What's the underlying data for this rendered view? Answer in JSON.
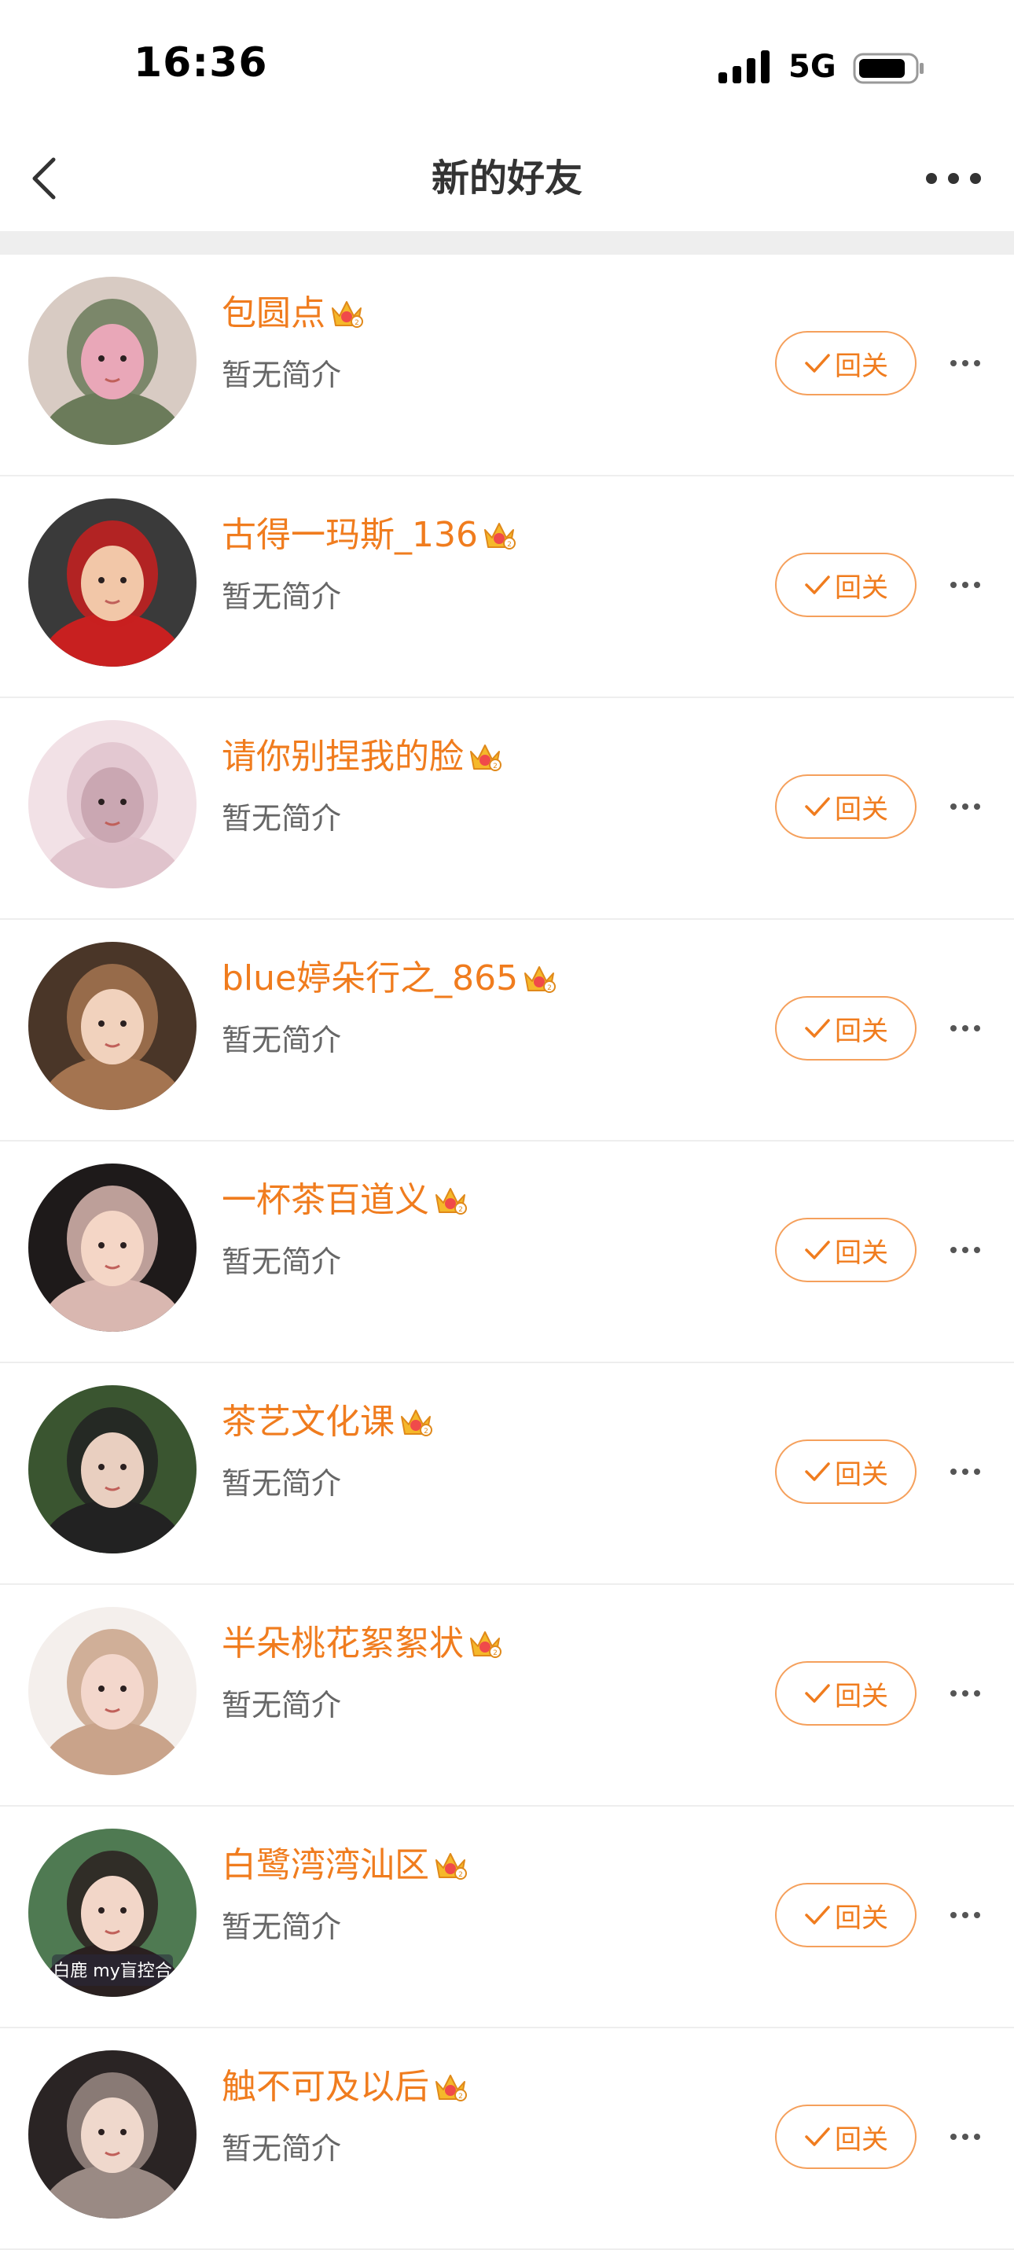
{
  "status_bar": {
    "time": "16:36",
    "network": "5G"
  },
  "nav": {
    "title": "新的好友",
    "back_icon": "chevron-left-icon",
    "more_icon": "more-horizontal-icon"
  },
  "colors": {
    "accent": "#f07c1e",
    "button_border": "#f5a05c",
    "divider": "#eeeeee"
  },
  "friends": [
    {
      "name": "包圆点",
      "bio": "暂无简介",
      "button": "回关",
      "avatar_colors": [
        "#d8cbc3",
        "#6b7b5a",
        "#e9a7b8"
      ]
    },
    {
      "name": "古得一玛斯_136",
      "bio": "暂无简介",
      "button": "回关",
      "avatar_colors": [
        "#3a3a3a",
        "#c82020",
        "#f2c7a8"
      ]
    },
    {
      "name": "请你别捏我的脸",
      "bio": "暂无简介",
      "button": "回关",
      "avatar_colors": [
        "#f2e1e6",
        "#e0c3cc",
        "#caa7b2"
      ]
    },
    {
      "name": "blue婷朵行之_865",
      "bio": "暂无简介",
      "button": "回关",
      "avatar_colors": [
        "#4a3628",
        "#a47450",
        "#f1d2bd"
      ]
    },
    {
      "name": "一杯茶百道义",
      "bio": "暂无简介",
      "button": "回关",
      "avatar_colors": [
        "#1e1a1a",
        "#d9b7b0",
        "#f4d6c6"
      ]
    },
    {
      "name": "茶艺文化课",
      "bio": "暂无简介",
      "button": "回关",
      "avatar_colors": [
        "#3a5530",
        "#222222",
        "#e9cfc0"
      ]
    },
    {
      "name": "半朵桃花絮絮状",
      "bio": "暂无简介",
      "button": "回关",
      "avatar_colors": [
        "#f4efec",
        "#c9a38a",
        "#f3d7cc"
      ]
    },
    {
      "name": "白鹭湾湾汕区",
      "bio": "暂无简介",
      "button": "回关",
      "avatar_colors": [
        "#4f7a52",
        "#2a2020",
        "#f2d6c8"
      ],
      "avatar_caption": "白鹿 my盲控合"
    },
    {
      "name": "触不可及以后",
      "bio": "暂无简介",
      "button": "回关",
      "avatar_colors": [
        "#2a2424",
        "#9a8a84",
        "#efd8cc"
      ]
    }
  ]
}
